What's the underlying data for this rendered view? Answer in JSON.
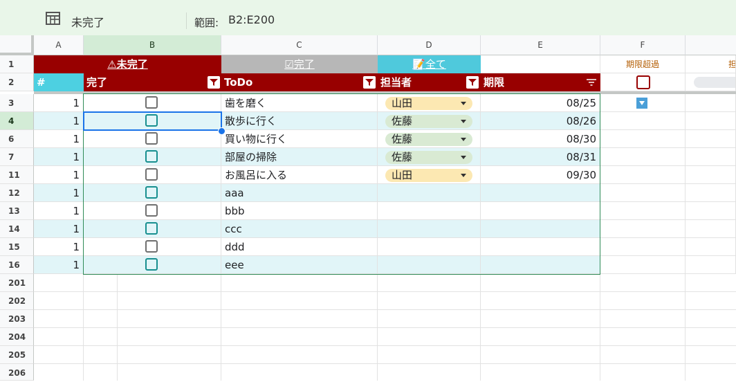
{
  "filter_view": {
    "name": "未完了",
    "range_label": "範囲:",
    "range_value": "B2:E200"
  },
  "columns": [
    "A",
    "B",
    "C",
    "D",
    "E",
    "F"
  ],
  "row_labels": [
    "1",
    "2",
    "3",
    "4",
    "6",
    "7",
    "11",
    "12",
    "13",
    "14",
    "15",
    "16",
    "201",
    "202",
    "203",
    "204",
    "205",
    "206"
  ],
  "row1": {
    "incomplete": "⚠未完了",
    "complete": "☑完了",
    "all": "📝全て",
    "overdue": "期限超過",
    "partial": "担"
  },
  "headers": {
    "num": "#",
    "done": "完了",
    "todo": "ToDo",
    "assignee": "担当者",
    "deadline": "期限"
  },
  "rows": [
    {
      "num": "1",
      "todo": "歯を磨く",
      "assignee": "山田",
      "deadline": "08/25"
    },
    {
      "num": "1",
      "todo": "散歩に行く",
      "assignee": "佐藤",
      "deadline": "08/26"
    },
    {
      "num": "1",
      "todo": "買い物に行く",
      "assignee": "佐藤",
      "deadline": "08/30"
    },
    {
      "num": "1",
      "todo": "部屋の掃除",
      "assignee": "佐藤",
      "deadline": "08/31"
    },
    {
      "num": "1",
      "todo": "お風呂に入る",
      "assignee": "山田",
      "deadline": "09/30"
    },
    {
      "num": "1",
      "todo": "aaa",
      "assignee": "",
      "deadline": ""
    },
    {
      "num": "1",
      "todo": "bbb",
      "assignee": "",
      "deadline": ""
    },
    {
      "num": "1",
      "todo": "ccc",
      "assignee": "",
      "deadline": ""
    },
    {
      "num": "1",
      "todo": "ddd",
      "assignee": "",
      "deadline": ""
    },
    {
      "num": "1",
      "todo": "eee",
      "assignee": "",
      "deadline": ""
    }
  ],
  "colors": {
    "header_red": "#980000",
    "complete_gray": "#b7b7b7",
    "all_cyan": "#4fc9dc",
    "num_header": "#4dd0e1",
    "band_cyan": "#e1f5f8",
    "chip_yamada": "#fce8b2",
    "chip_sato": "#d9ead3"
  },
  "icons": [
    "table-view-icon",
    "warning-icon",
    "checkbox-icon",
    "memo-icon",
    "filter-icon",
    "sort-icon",
    "dropdown-arrow-icon"
  ]
}
